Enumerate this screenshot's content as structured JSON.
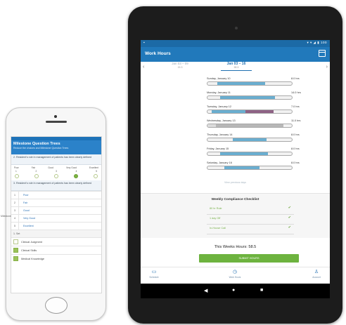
{
  "phone": {
    "title": "Milestone Question Trees",
    "subtitle": "Reduce the choices and Milestone Question Trees",
    "q1": "2. Resident's role in management of patients has been clearly defined",
    "scale_labels": [
      "Poor",
      "Fair",
      "Good",
      "Very Good",
      "Excellent"
    ],
    "scale_nums": [
      "1",
      "2",
      "3",
      "4",
      "5"
    ],
    "selected_index": 3,
    "q2": "3. Resident's role in management of patients has been clearly defined",
    "options": [
      {
        "n": "1",
        "label": "Poor"
      },
      {
        "n": "2",
        "label": "Fair"
      },
      {
        "n": "3",
        "label": "Good"
      },
      {
        "n": "4",
        "label": "Very Good"
      },
      {
        "n": "5",
        "label": "Excellent"
      }
    ],
    "section": "1. Set",
    "checkboxes": [
      {
        "label": "Clinical Judgment",
        "checked": false
      },
      {
        "label": "Clinical Skills",
        "checked": true
      },
      {
        "label": "Medical Knowledge",
        "checked": true
      }
    ]
  },
  "left_label": "Milestone",
  "tablet": {
    "status_right": "▾ ▾ ◢ ▮ 100",
    "title": "Work Hours",
    "prev_week": {
      "dates": "Jan 03 – 09",
      "sub": "15.3"
    },
    "cur_week": {
      "dates": "Jan 03 – 16",
      "sub": "58.5"
    },
    "days": [
      {
        "name": "Sunday, January 10",
        "hours": "8.0 hrs",
        "segs": [
          {
            "s": 0.12,
            "e": 0.68,
            "c": "#6aaed0"
          }
        ]
      },
      {
        "name": "Monday, January 11",
        "hours": "14.0 hrs",
        "segs": [
          {
            "s": 0.15,
            "e": 0.8,
            "c": "#6aaed0"
          }
        ]
      },
      {
        "name": "Tuesday, January 12",
        "hours": "7.0 hrs",
        "segs": [
          {
            "s": 0.05,
            "e": 0.45,
            "c": "#6aaed0"
          },
          {
            "s": 0.45,
            "e": 0.78,
            "c": "#8e6285"
          }
        ]
      },
      {
        "name": "Wednesday, January 13",
        "hours": "11.0 hrs",
        "segs": [
          {
            "s": 0.0,
            "e": 0.1,
            "c": "#dcdcdc"
          },
          {
            "s": 0.1,
            "e": 0.9,
            "c": "#b7b7b7"
          }
        ]
      },
      {
        "name": "Thursday, January 14",
        "hours": "8.0 hrs",
        "segs": [
          {
            "s": 0.3,
            "e": 0.7,
            "c": "#6aaed0"
          }
        ]
      },
      {
        "name": "Friday, January 15",
        "hours": "8.0 hrs",
        "segs": [
          {
            "s": 0.15,
            "e": 0.72,
            "c": "#6aaed0"
          }
        ]
      },
      {
        "name": "Saturday, January 16",
        "hours": "8.0 hrs",
        "segs": [
          {
            "s": 0.2,
            "e": 0.62,
            "c": "#6aaed0"
          }
        ]
      }
    ],
    "more": "View previous days",
    "checklist_title": "Weekly Compliance Checklist",
    "checklist": [
      {
        "label": "80 hr Rule",
        "mark": "✔"
      },
      {
        "label": "1 day Off",
        "mark": "✔"
      },
      {
        "label": "In-House Call",
        "mark": "✔"
      }
    ],
    "total": "This Weeks Hours: 58.5",
    "submit": "SUBMIT HOURS",
    "nav": [
      {
        "icon": "calendar",
        "label": "Schedule"
      },
      {
        "icon": "clock",
        "label": "Work Hours"
      },
      {
        "icon": "user",
        "label": "Account"
      }
    ]
  }
}
